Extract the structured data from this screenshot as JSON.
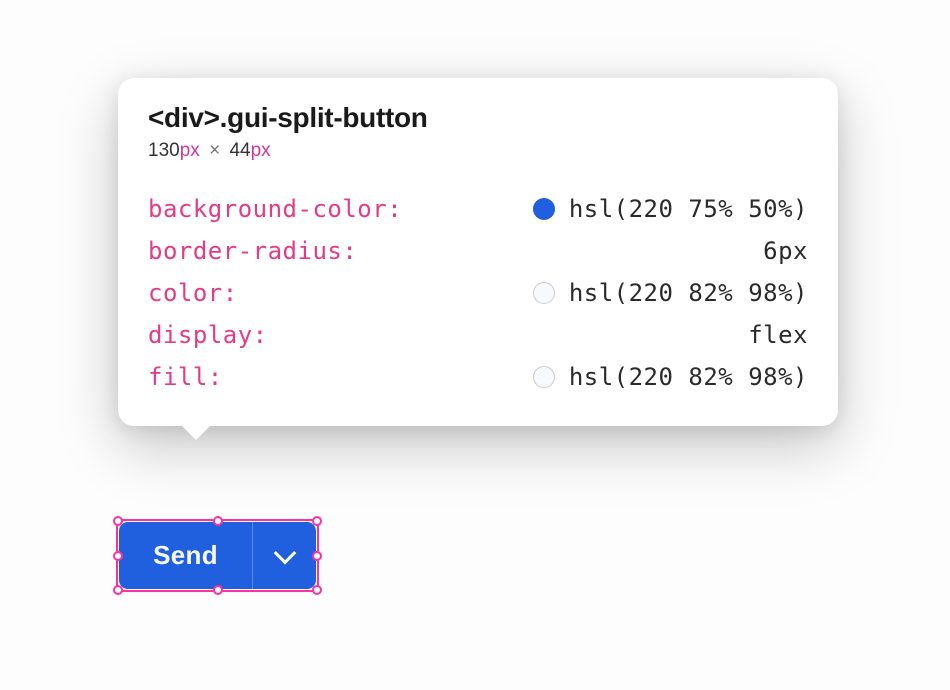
{
  "tooltip": {
    "selector_tag": "<div>",
    "selector_class": ".gui-split-button",
    "width_value": "130",
    "width_unit": "px",
    "dim_sep": "×",
    "height_value": "44",
    "height_unit": "px",
    "rows": {
      "bg": {
        "prop": "background-color",
        "value": "hsl(220 75% 50%)",
        "swatch": "blue"
      },
      "br": {
        "prop": "border-radius",
        "value": "6px"
      },
      "col": {
        "prop": "color",
        "value": "hsl(220 82% 98%)",
        "swatch": "white"
      },
      "disp": {
        "prop": "display",
        "value": "flex"
      },
      "fill": {
        "prop": "fill",
        "value": "hsl(220 82% 98%)",
        "swatch": "white"
      }
    }
  },
  "button": {
    "label": "Send"
  }
}
